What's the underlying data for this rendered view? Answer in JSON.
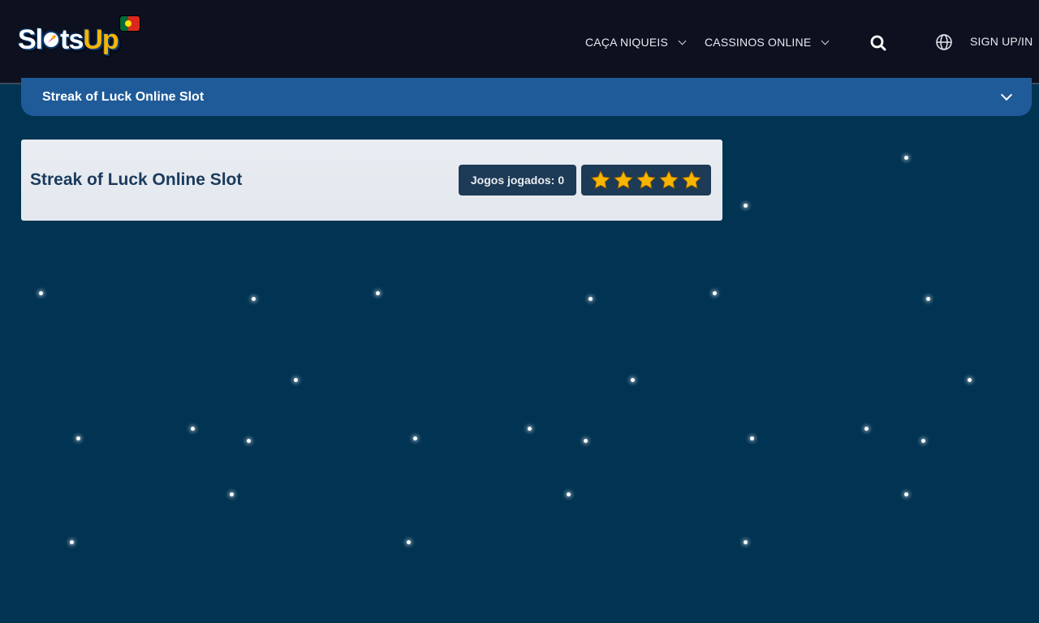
{
  "header": {
    "logo": {
      "part1": "Sl",
      "part2": "ts",
      "part3": "Up"
    },
    "nav": [
      {
        "label": "CAÇA NIQUEIS"
      },
      {
        "label": "CASSINOS ONLINE"
      }
    ],
    "sign_label": "SIGN UP/IN",
    "icons": {
      "search": "search-icon",
      "language": "globe-icon",
      "flag": "portugal-flag-icon"
    }
  },
  "breadcrumb": {
    "title": "Streak of Luck Online Slot"
  },
  "card": {
    "title": "Streak of Luck Online Slot",
    "played_label": "Jogos jogados:",
    "played_count": "0",
    "rating": 5
  },
  "colors": {
    "background": "#013352",
    "header": "#0d111f",
    "bar": "#1f5b99",
    "star": "#f7b500"
  }
}
